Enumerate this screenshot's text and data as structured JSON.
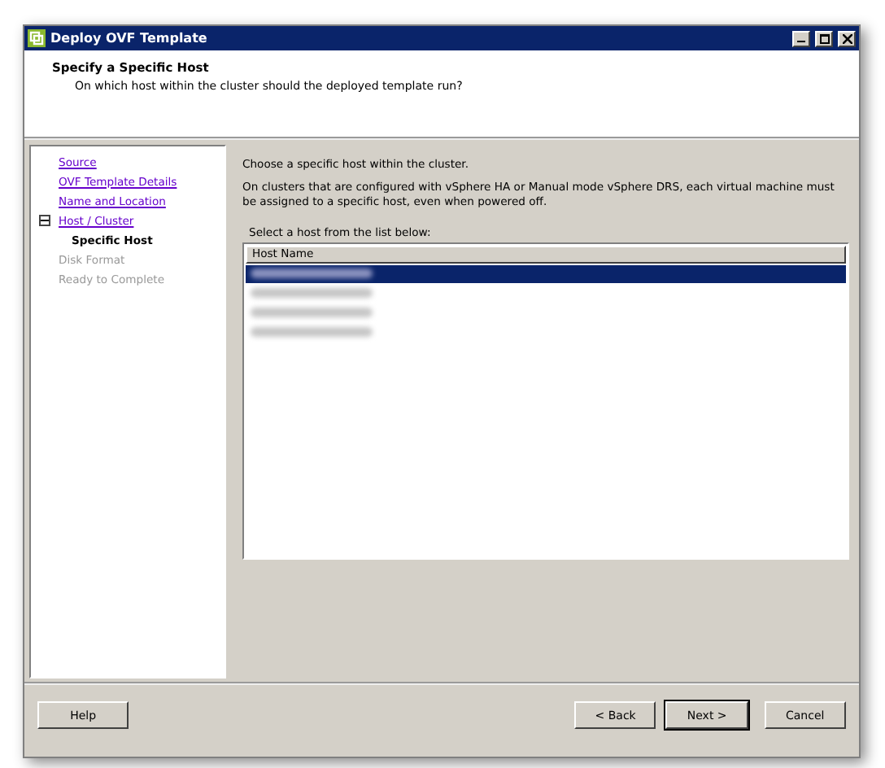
{
  "window": {
    "title": "Deploy OVF Template"
  },
  "header": {
    "title": "Specify a Specific Host",
    "subtitle": "On which host within the cluster should the deployed template run?"
  },
  "steps": [
    {
      "label": "Source",
      "kind": "link"
    },
    {
      "label": "OVF Template Details",
      "kind": "link"
    },
    {
      "label": "Name and Location",
      "kind": "link"
    },
    {
      "label": "Host / Cluster",
      "kind": "link",
      "expanded": true,
      "children": [
        {
          "label": "Specific Host",
          "kind": "current"
        }
      ]
    },
    {
      "label": "Disk Format",
      "kind": "disabled"
    },
    {
      "label": "Ready to Complete",
      "kind": "disabled"
    }
  ],
  "content": {
    "intro": "Choose a specific host within the cluster.",
    "note": "On clusters that are configured with vSphere HA or Manual mode vSphere DRS, each virtual machine must be assigned to a specific host, even when powered off.",
    "list_label": "Select a host from the list below:"
  },
  "host_table": {
    "columns": [
      "Host Name"
    ],
    "rows": [
      {
        "selected": true
      },
      {
        "selected": false
      },
      {
        "selected": false
      },
      {
        "selected": false
      }
    ]
  },
  "buttons": [
    {
      "label": "Help",
      "kind": "help"
    },
    {
      "label": "< Back",
      "kind": "back"
    },
    {
      "label": "Next >",
      "kind": "next"
    },
    {
      "label": "Cancel",
      "kind": "cancel"
    }
  ]
}
